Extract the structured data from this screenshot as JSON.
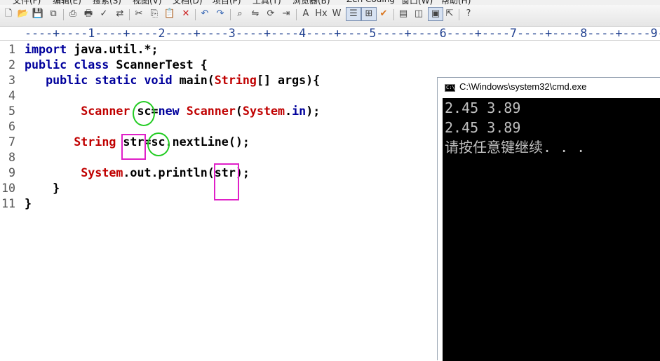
{
  "menu": {
    "items": [
      "文件(F)",
      "编辑(E)",
      "搜索(S)",
      "视图(V)",
      "文档(D)",
      "项目(P)",
      "工具(T)",
      "浏览器(B)",
      "Zen Coding",
      "窗口(W)",
      "帮助(H)"
    ]
  },
  "toolbar": {
    "icons": [
      {
        "name": "new-file-icon",
        "glyph": "🗋"
      },
      {
        "name": "open-file-icon",
        "glyph": "📂"
      },
      {
        "name": "save-icon",
        "glyph": "💾"
      },
      {
        "name": "save-all-icon",
        "glyph": "⧉"
      },
      {
        "name": "print-preview-icon",
        "glyph": "⎙"
      },
      {
        "name": "print-icon",
        "glyph": "🖶"
      },
      {
        "name": "spell-check-icon",
        "glyph": "✓"
      },
      {
        "name": "ftp-icon",
        "glyph": "⇄"
      },
      {
        "name": "cut-icon",
        "glyph": "✂"
      },
      {
        "name": "copy-icon",
        "glyph": "⎘"
      },
      {
        "name": "paste-icon",
        "glyph": "📋"
      },
      {
        "name": "delete-icon",
        "glyph": "✕"
      },
      {
        "name": "undo-icon",
        "glyph": "↶"
      },
      {
        "name": "redo-icon",
        "glyph": "↷"
      },
      {
        "name": "find-icon",
        "glyph": "⌕"
      },
      {
        "name": "replace-icon",
        "glyph": "⇋"
      },
      {
        "name": "find-in-files-icon",
        "glyph": "⟳"
      },
      {
        "name": "goto-line-icon",
        "glyph": "⇥"
      },
      {
        "name": "font-icon",
        "glyph": "A"
      },
      {
        "name": "hex-icon",
        "glyph": "Hx"
      },
      {
        "name": "word-wrap-icon",
        "glyph": "W"
      },
      {
        "name": "line-numbers-icon",
        "glyph": "☰"
      },
      {
        "name": "column-mode-icon",
        "glyph": "⊞"
      },
      {
        "name": "validate-icon",
        "glyph": "✔"
      },
      {
        "name": "show-panel-icon",
        "glyph": "▤"
      },
      {
        "name": "split-view-icon",
        "glyph": "◫"
      },
      {
        "name": "fullscreen-icon",
        "glyph": "▣"
      },
      {
        "name": "external-app-icon",
        "glyph": "⇱"
      },
      {
        "name": "context-help-icon",
        "glyph": "?"
      }
    ]
  },
  "ruler": {
    "text": "----+----1----+----2----+----3----+----4----+----5----+----6----+----7----+----8----+----9-"
  },
  "editor": {
    "line_numbers": [
      "1",
      "2",
      "3",
      "4",
      "5",
      "6",
      "7",
      "8",
      "9",
      "10",
      "11"
    ],
    "lines": [
      [
        {
          "t": "kw",
          "s": "import"
        },
        {
          "t": "pl",
          "s": " java.util.*;"
        }
      ],
      [
        {
          "t": "kw",
          "s": "public class"
        },
        {
          "t": "pl",
          "s": " ScannerTest {"
        }
      ],
      [
        {
          "t": "pl",
          "s": "   "
        },
        {
          "t": "kw",
          "s": "public static void"
        },
        {
          "t": "pl",
          "s": " main("
        },
        {
          "t": "ty",
          "s": "String"
        },
        {
          "t": "pl",
          "s": "[] args){"
        }
      ],
      [],
      [
        {
          "t": "pl",
          "s": "        "
        },
        {
          "t": "ty",
          "s": "Scanner"
        },
        {
          "t": "pl",
          "s": " sc="
        },
        {
          "t": "kw",
          "s": "new"
        },
        {
          "t": "pl",
          "s": " "
        },
        {
          "t": "ty",
          "s": "Scanner"
        },
        {
          "t": "pl",
          "s": "("
        },
        {
          "t": "ty",
          "s": "System"
        },
        {
          "t": "pl",
          "s": "."
        },
        {
          "t": "kw",
          "s": "in"
        },
        {
          "t": "pl",
          "s": ");"
        }
      ],
      [],
      [
        {
          "t": "pl",
          "s": "       "
        },
        {
          "t": "ty",
          "s": "String"
        },
        {
          "t": "pl",
          "s": " str=sc.nextLine();"
        }
      ],
      [],
      [
        {
          "t": "pl",
          "s": "        "
        },
        {
          "t": "ty",
          "s": "System"
        },
        {
          "t": "pl",
          "s": ".out.println(str);"
        }
      ],
      [
        {
          "t": "pl",
          "s": "    }"
        }
      ],
      [
        {
          "t": "pl",
          "s": "}"
        }
      ]
    ]
  },
  "console": {
    "title": "C:\\Windows\\system32\\cmd.exe",
    "lines": [
      "2.45 3.89",
      "2.45 3.89",
      "请按任意键继续. . ."
    ]
  },
  "colors": {
    "keyword": "#00009c",
    "type": "#c00000",
    "highlight_circle": "#22cc22",
    "highlight_box": "#e020c8"
  }
}
